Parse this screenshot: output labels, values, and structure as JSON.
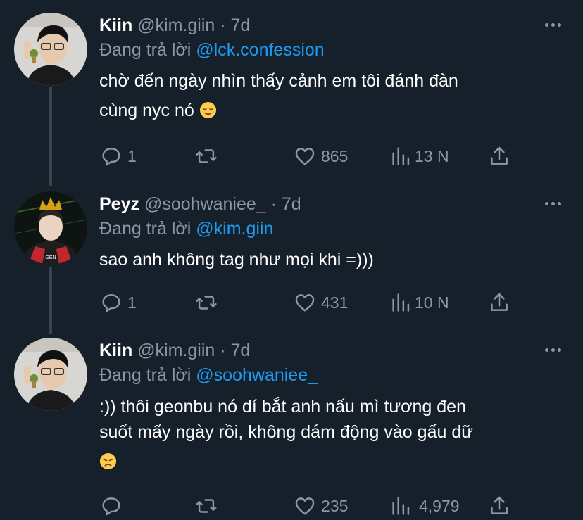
{
  "tweets": [
    {
      "name": "Kiin",
      "handle": "@kim.giin",
      "separator": "·",
      "time": "7d",
      "reply_prefix": "Đang trả lời",
      "reply_to": "@lck.confession",
      "lines": [
        "chờ đến ngày nhìn thấy cảnh em tôi đánh đàn",
        "cùng nyc nó"
      ],
      "emoji": "relieved-face",
      "replies": "1",
      "likes": "865",
      "views": "13 N"
    },
    {
      "name": "Peyz",
      "handle": "@soohwaniee_",
      "separator": "·",
      "time": "7d",
      "reply_prefix": "Đang trả lời",
      "reply_to": "@kim.giin",
      "lines": [
        "sao anh không tag như mọi khi =)))"
      ],
      "replies": "1",
      "likes": "431",
      "views": "10 N"
    },
    {
      "name": "Kiin",
      "handle": "@kim.giin",
      "separator": "·",
      "time": "7d",
      "reply_prefix": "Đang trả lời",
      "reply_to": "@soohwaniee_",
      "lines": [
        ":)) thôi geonbu nó dí bắt anh nấu mì tương đen",
        "suốt mấy ngày rồi, không dám động vào gấu dữ"
      ],
      "emoji": "disappointed-face",
      "replies": "",
      "likes": "235",
      "views": "4,979"
    }
  ],
  "colors": {
    "background": "#15202b",
    "secondary_text": "#8b98a5",
    "mention": "#1d9bf0",
    "thread_line": "#38444d"
  }
}
